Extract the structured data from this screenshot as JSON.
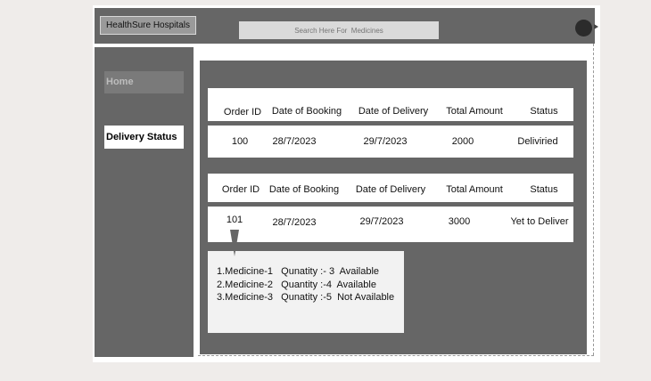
{
  "header": {
    "brand": "HealthSure Hospitals",
    "search_placeholder": "Search Here For  Medicines",
    "avatar_icon": "user-avatar-icon"
  },
  "sidebar": {
    "items": [
      {
        "label": "Home",
        "active": false
      },
      {
        "label": "Delivery Status",
        "active": true
      }
    ]
  },
  "orders": {
    "columns": [
      "Order ID",
      "Date of Booking",
      "Date of Delivery",
      "Total Amount",
      "Status"
    ],
    "rows": [
      {
        "order_id": "100",
        "booking": "28/7/2023",
        "delivery": "29/7/2023",
        "amount": "2000",
        "status": "Deliviried"
      },
      {
        "order_id": "101",
        "booking": "28/7/2023",
        "delivery": "29/7/2023",
        "amount": "3000",
        "status": "Yet to Deliver"
      }
    ]
  },
  "medicine_popup": {
    "lines": [
      "1.Medicine-1   Qunatity :- 3  Available",
      "2.Medicine-2   Quantity :-4  Available",
      "3.Medicine-3   Qunatity :-5  Not Available"
    ]
  },
  "colors": {
    "panel": "#666666",
    "highlight": "#ffffff",
    "inactive_nav": "#7a7a7a"
  }
}
